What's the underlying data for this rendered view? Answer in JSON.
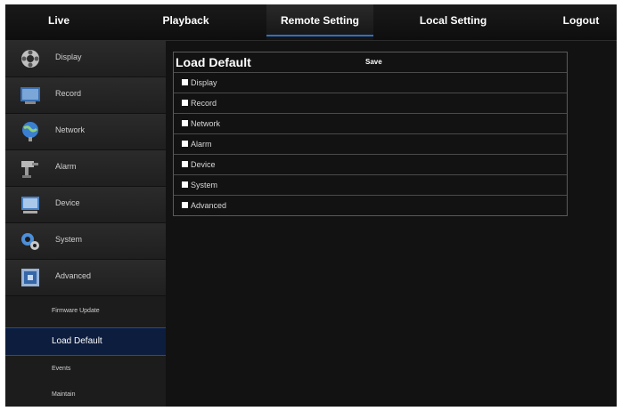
{
  "topnav": {
    "tabs": [
      {
        "label": "Live"
      },
      {
        "label": "Playback"
      },
      {
        "label": "Remote Setting"
      },
      {
        "label": "Local Setting"
      },
      {
        "label": "Logout"
      }
    ],
    "active_tab": "Remote Setting"
  },
  "sidebar": {
    "items": [
      {
        "label": "Display",
        "icon": "display-icon"
      },
      {
        "label": "Record",
        "icon": "record-icon"
      },
      {
        "label": "Network",
        "icon": "network-icon"
      },
      {
        "label": "Alarm",
        "icon": "alarm-icon"
      },
      {
        "label": "Device",
        "icon": "device-icon"
      },
      {
        "label": "System",
        "icon": "system-icon"
      },
      {
        "label": "Advanced",
        "icon": "advanced-icon"
      }
    ],
    "sub_items": [
      {
        "label": "Firmware Update"
      },
      {
        "label": "Load Default"
      },
      {
        "label": "Events"
      },
      {
        "label": "Maintain"
      }
    ],
    "active_sub_item": "Load Default"
  },
  "main": {
    "title": "Load Default",
    "save_label": "Save",
    "options": [
      {
        "label": "Display"
      },
      {
        "label": "Record"
      },
      {
        "label": "Network"
      },
      {
        "label": "Alarm"
      },
      {
        "label": "Device"
      },
      {
        "label": "System"
      },
      {
        "label": "Advanced"
      }
    ]
  },
  "colors": {
    "background": "#141414",
    "accent": "#2f6fc6",
    "active_sub_bg": "#0c1d3e",
    "text": "#ffffff"
  }
}
